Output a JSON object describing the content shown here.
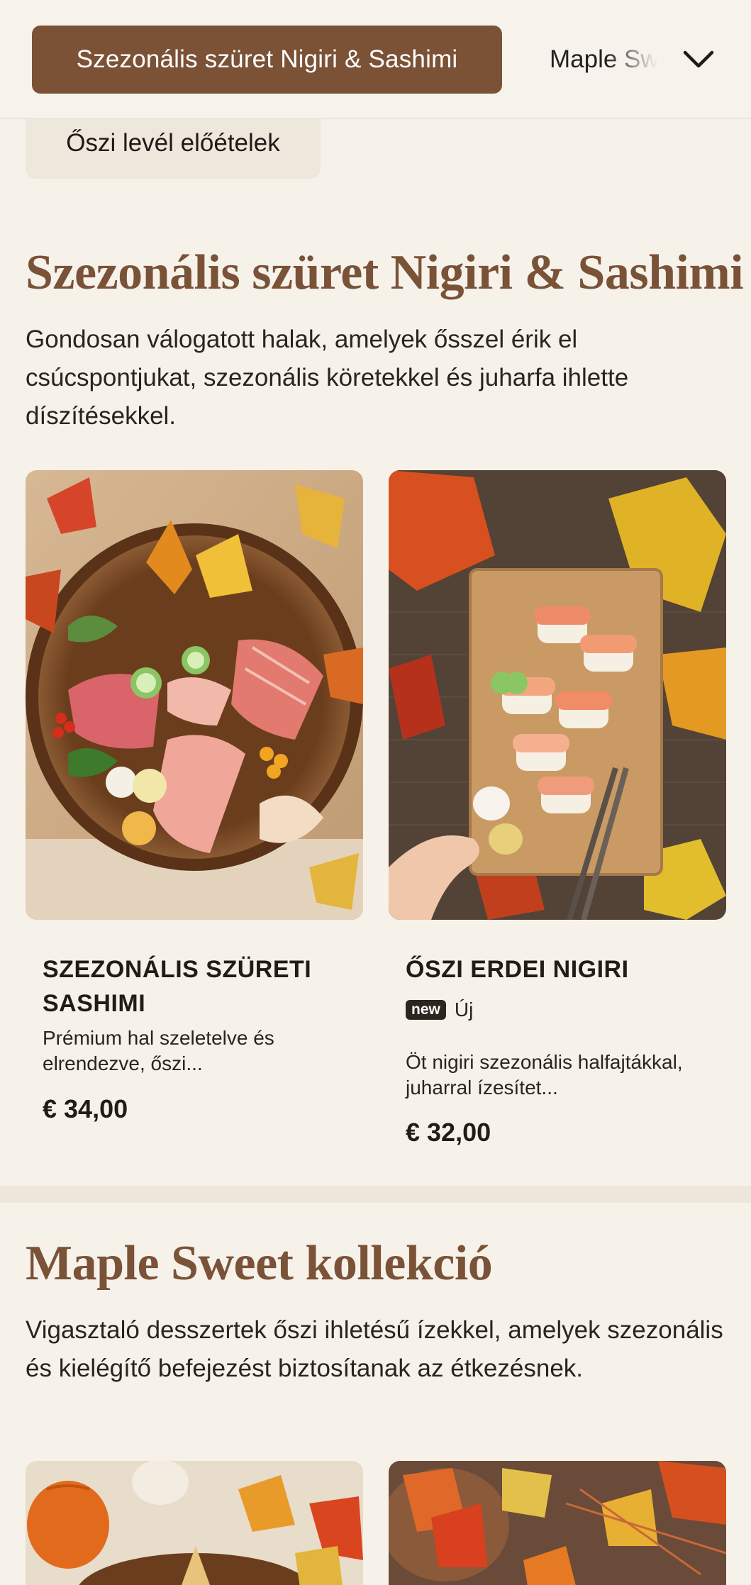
{
  "category_nav": {
    "active": "Szezonális szüret Nigiri & Sashimi",
    "next": "Maple Sweet kollekció",
    "previous": "Őszi levél előételek",
    "expand_icon": "chevron-down-icon"
  },
  "sections": [
    {
      "title": "Szezonális szüret Nigiri & Sashimi",
      "description": "Gondosan válogatott halak, amelyek ősszel érik el csúcspontjukat, szezonális köretekkel és juharfa ihlette díszítésekkel.",
      "items": [
        {
          "name": "SZEZONÁLIS SZÜRETI SASHIMI",
          "description": "Prémium hal szeletelve és elrendezve, őszi...",
          "price": "€ 34,00"
        },
        {
          "name": "ŐSZI ERDEI NIGIRI",
          "badge": "new",
          "badge_label": "Új",
          "description": "Öt nigiri szezonális halfajtákkal, juharral ízesítet...",
          "price": "€ 32,00"
        }
      ]
    },
    {
      "title": "Maple Sweet kollekció",
      "description": "Vigasztaló desszertek őszi ihletésű ízekkel, amelyek szezonális és kielégítő befejezést biztosítanak az étkezésnek."
    }
  ],
  "colors": {
    "brand": "#7b5236",
    "background": "#f6f2ea",
    "title": "#7a5238"
  }
}
